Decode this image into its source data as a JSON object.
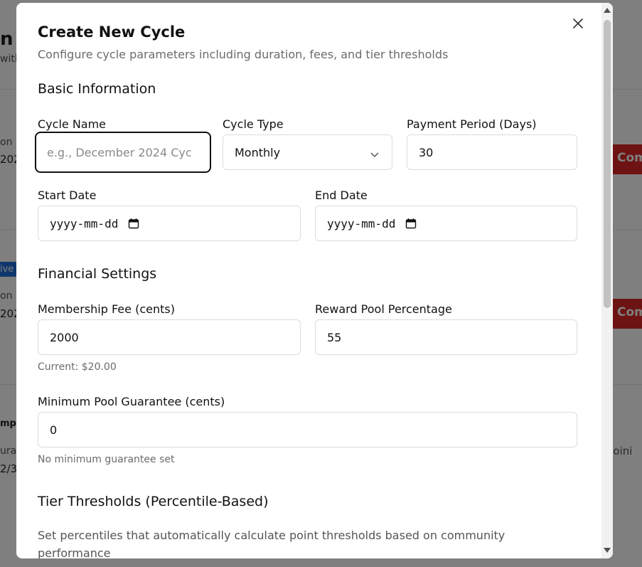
{
  "background": {
    "fragments": [
      "n",
      "with",
      "on",
      "202",
      "ive",
      "on",
      "202",
      "mpl",
      "ura",
      "2/3"
    ],
    "buttons": [
      "Com",
      "Com"
    ],
    "right_text": "Joini"
  },
  "modal": {
    "title": "Create New Cycle",
    "subtitle": "Configure cycle parameters including duration, fees, and tier thresholds",
    "close_icon": "close-icon",
    "basic": {
      "heading": "Basic Information",
      "cycle_name": {
        "label": "Cycle Name",
        "placeholder": "e.g., December 2024 Cyc",
        "value": ""
      },
      "cycle_type": {
        "label": "Cycle Type",
        "value": "Monthly"
      },
      "payment_period": {
        "label": "Payment Period (Days)",
        "value": "30"
      },
      "start_date": {
        "label": "Start Date",
        "value": "yyyy-mm-dd"
      },
      "end_date": {
        "label": "End Date",
        "value": "yyyy-mm-dd"
      }
    },
    "financial": {
      "heading": "Financial Settings",
      "membership_fee": {
        "label": "Membership Fee (cents)",
        "value": "2000",
        "hint": "Current: $20.00"
      },
      "reward_pool": {
        "label": "Reward Pool Percentage",
        "value": "55"
      },
      "min_pool": {
        "label": "Minimum Pool Guarantee (cents)",
        "value": "0",
        "hint": "No minimum guarantee set"
      }
    },
    "tiers": {
      "heading": "Tier Thresholds (Percentile-Based)",
      "description": "Set percentiles that automatically calculate point thresholds based on community performance"
    }
  }
}
